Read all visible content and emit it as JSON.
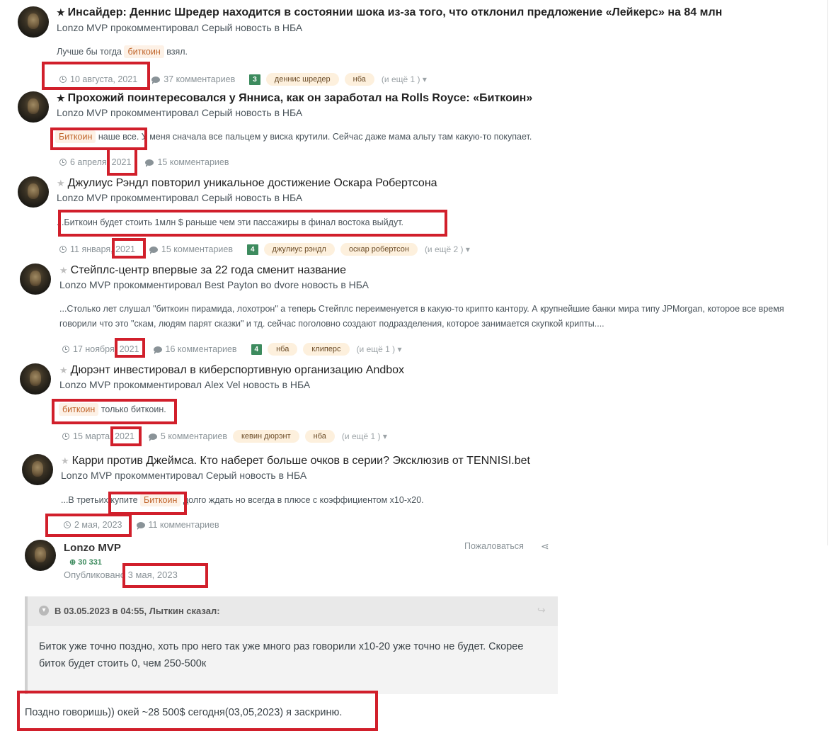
{
  "feed": [
    {
      "title": "Инсайдер: Деннис Шредер находится в состоянии шока из-за того, что отклонил предложение «Лейкерс» на 84 млн",
      "featured": true,
      "byline": "Lonzo MVP прокомментировал Серый новость в НБА",
      "snippet_pre": "Лучше бы тогда",
      "snippet_highlight": "биткоин",
      "snippet_post": "взял.",
      "date": "10 августа, 2021",
      "comments": "37 комментариев",
      "badge": "3",
      "tags": [
        "деннис шредер",
        "нба"
      ],
      "more": "(и ещё 1 ) ▾"
    },
    {
      "title": "Прохожий поинтересовался у Янниса, как он заработал на Rolls Royce: «Биткоин»",
      "featured": true,
      "byline": "Lonzo MVP прокомментировал Серый новость в НБА",
      "snippet_highlight": "Биткоин",
      "snippet_post": "наше все. У меня сначала все пальцем у виска крутили. Сейчас даже мама альту там какую-то покупает.",
      "date": "6 апреля, 2021",
      "comments": "15 комментариев"
    },
    {
      "title": "Джулиус Рэндл повторил уникальное достижение Оскара Робертсона",
      "featured": false,
      "byline": "Lonzo MVP прокомментировал Серый новость в НБА",
      "snippet": "...Биткоин будет стоить 1млн $ раньше чем эти пассажиры в финал востока выйдут.",
      "date": "11 января, 2021",
      "comments": "15 комментариев",
      "badge": "4",
      "tags": [
        "джулиус рэндл",
        "оскар робертсон"
      ],
      "more": "(и ещё 2 ) ▾"
    },
    {
      "title": "Стейплс-центр впервые за 22 года сменит название",
      "featured": false,
      "byline": "Lonzo MVP прокомментировал Best Payton во dvore новость в НБА",
      "snippet": "...Столько лет слушал \"биткоин пирамида, лохотрон\" а теперь Стейплс переименуется в какую-то крипто кантору. А крупнейшие банки мира типу JPMorgan, которое все время говорили что это \"скам, людям парят сказки\" и тд. сейчас поголовно создают подразделения, которое занимается скупкой крипты....",
      "date": "17 ноября, 2021",
      "comments": "16 комментариев",
      "badge": "4",
      "tags": [
        "нба",
        "клиперс"
      ],
      "more": "(и ещё 1 ) ▾"
    },
    {
      "title": "Дюрэнт инвестировал в киберспортивную организацию Andbox",
      "featured": false,
      "byline": "Lonzo MVP прокомментировал Alex Vel новость в НБА",
      "snippet_highlight": "биткоин",
      "snippet_post": "только биткоин.",
      "date": "15 марта, 2021",
      "comments": "5 комментариев",
      "tags": [
        "кевин дюрэнт",
        "нба"
      ],
      "more": "(и ещё 1 ) ▾"
    },
    {
      "title": "Карри против Джеймса. Кто наберет больше очков в серии? Эксклюзив от TENNISI.bet",
      "featured": false,
      "byline": "Lonzo MVP прокомментировал Серый новость в НБА",
      "snippet_pre": "...В третьих купите",
      "snippet_highlight": "Биткоин",
      "snippet_post": "долго ждать но всегда в плюсе с коэффициентом х10-х20.",
      "date": "2 мая, 2023",
      "comments": "11 комментариев"
    }
  ],
  "post": {
    "author": "Lonzo MVP",
    "reputation": "30 331",
    "published_label": "Опубликовано",
    "published_date": "3 мая, 2023",
    "report": "Пожаловаться",
    "quote_header": "В 03.05.2023 в 04:55, Лыткин сказал:",
    "quote_text": "Биток уже точно поздно, хоть про него так уже много раз говорили х10-20 уже точно не будет. Скорее биток будет стоить 0, чем 250-500к",
    "reply": "Поздно говоришь)) окей ~28 500$ сегодня(03,05,2023) я заскриню."
  },
  "colors": {
    "highlight_bg": "#fdf1e6",
    "highlight_text": "#c0652b",
    "annotation_red": "#d11f2b",
    "badge_green": "#3d8b5e"
  }
}
